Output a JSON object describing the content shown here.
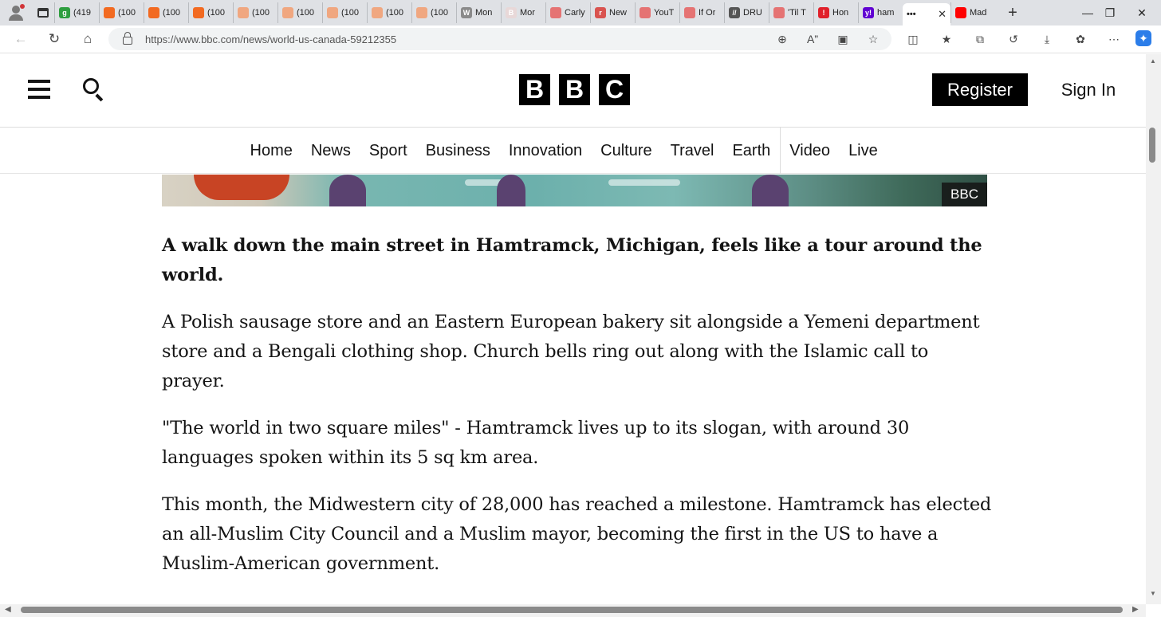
{
  "browser": {
    "tabs": [
      {
        "title": "(419",
        "color": "#2e9e3f",
        "glyph": "g"
      },
      {
        "title": "(100",
        "color": "#f26a21",
        "glyph": ""
      },
      {
        "title": "(100",
        "color": "#f26a21",
        "glyph": ""
      },
      {
        "title": "(100",
        "color": "#f26a21",
        "glyph": ""
      },
      {
        "title": "(100",
        "color": "#f0a780",
        "glyph": ""
      },
      {
        "title": "(100",
        "color": "#f0a780",
        "glyph": ""
      },
      {
        "title": "(100",
        "color": "#f0a780",
        "glyph": ""
      },
      {
        "title": "(100",
        "color": "#f0a780",
        "glyph": ""
      },
      {
        "title": "(100",
        "color": "#f0a780",
        "glyph": ""
      },
      {
        "title": "Mon",
        "color": "#8a8a8a",
        "glyph": "W"
      },
      {
        "title": "Mor",
        "color": "#e8d8d8",
        "glyph": "B"
      },
      {
        "title": "Carly",
        "color": "#e57373",
        "glyph": ""
      },
      {
        "title": "New",
        "color": "#d9534f",
        "glyph": "r"
      },
      {
        "title": "YouT",
        "color": "#e57373",
        "glyph": ""
      },
      {
        "title": "If Or",
        "color": "#e57373",
        "glyph": ""
      },
      {
        "title": "DRU",
        "color": "#555555",
        "glyph": "//"
      },
      {
        "title": "'Til T",
        "color": "#e57373",
        "glyph": ""
      },
      {
        "title": "Hon",
        "color": "#e0202a",
        "glyph": "!"
      },
      {
        "title": "ham",
        "color": "#6001d2",
        "glyph": "y!"
      },
      {
        "title": "•••",
        "color": "#ffffff",
        "glyph": ""
      },
      {
        "title": "Mad",
        "color": "#ff0000",
        "glyph": ""
      }
    ],
    "active_tab_close": "✕",
    "new_tab": "+",
    "url": "https://www.bbc.com/news/world-us-canada-59212355"
  },
  "header": {
    "logo_letters": [
      "B",
      "B",
      "C"
    ],
    "register_label": "Register",
    "signin_label": "Sign In"
  },
  "nav": {
    "items": [
      "Home",
      "News",
      "Sport",
      "Business",
      "Innovation",
      "Culture",
      "Travel",
      "Earth",
      "Video",
      "Live"
    ]
  },
  "hero": {
    "credit": "BBC"
  },
  "article": {
    "paragraphs": [
      "A walk down the main street in Hamtramck, Michigan, feels like a tour around the world.",
      "A Polish sausage store and an Eastern European bakery sit alongside a Yemeni department store and a Bengali clothing shop. Church bells ring out along with the Islamic call to prayer.",
      "\"The world in two square miles\" - Hamtramck lives up to its slogan, with around 30 languages spoken within its 5 sq km area.",
      "This month, the Midwestern city of 28,000 has reached a milestone. Hamtramck has elected an all-Muslim City Council and a Muslim mayor, becoming the first in the US to have a Muslim-American government."
    ]
  },
  "colors": {
    "bbc_black": "#000000",
    "text": "#141414",
    "chrome_bg": "#dfe1e5"
  }
}
